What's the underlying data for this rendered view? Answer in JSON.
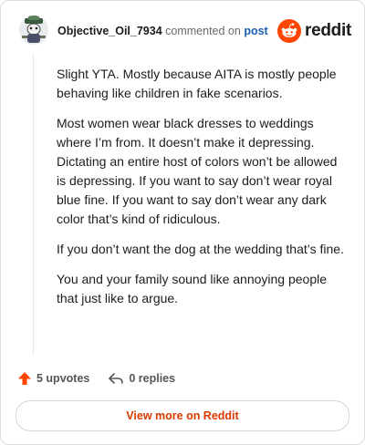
{
  "comment": {
    "author": "Objective_Oil_7934",
    "action_text": "commented on",
    "post_link_label": "post",
    "paragraphs": [
      "Slight YTA. Mostly because AITA is mostly people behaving like children in fake scenarios.",
      "Most women wear black dresses to weddings where I’m from. It doesn’t make it depressing. Dictating an entire host of colors won’t be allowed is depressing. If you want to say don’t wear royal blue fine. If you want to say don’t wear any dark color that’s kind of ridiculous.",
      "If you don’t want the dog at the wedding that’s fine.",
      "You and your family sound like annoying people that just like to argue."
    ]
  },
  "brand": {
    "wordmark": "reddit",
    "logo_icon": "reddit-snoo-icon",
    "accent_color": "#ff4500"
  },
  "footer": {
    "upvotes_label": "5 upvotes",
    "upvote_icon": "upvote-arrow-icon",
    "replies_label": "0 replies",
    "reply_icon": "reply-arrow-icon"
  },
  "actions": {
    "view_more_label": "View more on Reddit"
  }
}
